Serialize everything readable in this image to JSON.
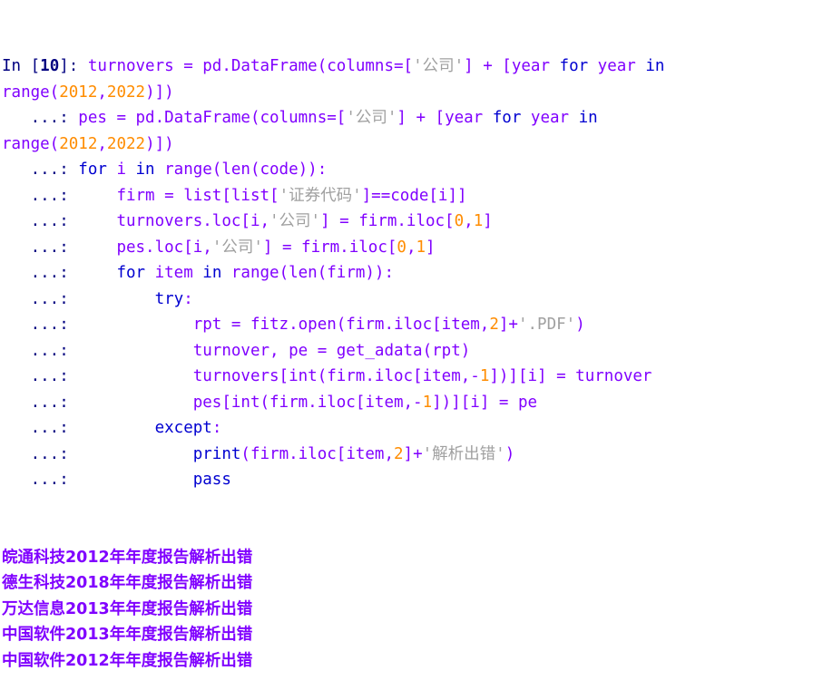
{
  "console": {
    "app": "IPython console",
    "prompts": {
      "in_label": "In",
      "in_open_bracket": "[",
      "in_number": "10",
      "in_close_bracket": "]:",
      "continuation": "   ...:"
    },
    "code_lines": [
      {
        "id": "line-1",
        "prompt_type": "in",
        "tokens": [
          {
            "t": "In ",
            "c": "prompt"
          },
          {
            "t": "[",
            "c": "prompt"
          },
          {
            "t": "10",
            "c": "prompt-num"
          },
          {
            "t": "]: ",
            "c": "prompt"
          },
          {
            "t": "turnovers = pd.DataFrame(columns=[",
            "c": "code"
          },
          {
            "t": "'公司'",
            "c": "str"
          },
          {
            "t": "] + [",
            "c": "code"
          },
          {
            "t": "year ",
            "c": "code"
          },
          {
            "t": "for",
            "c": "kw"
          },
          {
            "t": " year ",
            "c": "code"
          },
          {
            "t": "in",
            "c": "kw"
          },
          {
            "t": "",
            "c": "code"
          }
        ]
      },
      {
        "id": "line-2",
        "prompt_type": "wrap",
        "tokens": [
          {
            "t": "range(",
            "c": "code"
          },
          {
            "t": "2012",
            "c": "num"
          },
          {
            "t": ",",
            "c": "code"
          },
          {
            "t": "2022",
            "c": "num"
          },
          {
            "t": ")])",
            "c": "code"
          }
        ]
      },
      {
        "id": "line-3",
        "prompt_type": "cont",
        "tokens": [
          {
            "t": "   ...: ",
            "c": "prompt"
          },
          {
            "t": "pes = pd.DataFrame(columns=[",
            "c": "code"
          },
          {
            "t": "'公司'",
            "c": "str"
          },
          {
            "t": "] + [",
            "c": "code"
          },
          {
            "t": "year ",
            "c": "code"
          },
          {
            "t": "for",
            "c": "kw"
          },
          {
            "t": " year ",
            "c": "code"
          },
          {
            "t": "in",
            "c": "kw"
          },
          {
            "t": "",
            "c": "code"
          }
        ]
      },
      {
        "id": "line-4",
        "prompt_type": "wrap",
        "tokens": [
          {
            "t": "range(",
            "c": "code"
          },
          {
            "t": "2012",
            "c": "num"
          },
          {
            "t": ",",
            "c": "code"
          },
          {
            "t": "2022",
            "c": "num"
          },
          {
            "t": ")])",
            "c": "code"
          }
        ]
      },
      {
        "id": "line-5",
        "prompt_type": "cont",
        "tokens": [
          {
            "t": "   ...: ",
            "c": "prompt"
          },
          {
            "t": "for",
            "c": "kw"
          },
          {
            "t": " i ",
            "c": "code"
          },
          {
            "t": "in",
            "c": "kw"
          },
          {
            "t": " range(len(code)):",
            "c": "code"
          }
        ]
      },
      {
        "id": "line-6",
        "prompt_type": "cont",
        "tokens": [
          {
            "t": "   ...: ",
            "c": "prompt"
          },
          {
            "t": "    firm = list[list[",
            "c": "code"
          },
          {
            "t": "'证券代码'",
            "c": "str"
          },
          {
            "t": "]==code[i]]",
            "c": "code"
          }
        ]
      },
      {
        "id": "line-7",
        "prompt_type": "cont",
        "tokens": [
          {
            "t": "   ...: ",
            "c": "prompt"
          },
          {
            "t": "    turnovers.loc[i,",
            "c": "code"
          },
          {
            "t": "'公司'",
            "c": "str"
          },
          {
            "t": "] = firm.iloc[",
            "c": "code"
          },
          {
            "t": "0",
            "c": "num"
          },
          {
            "t": ",",
            "c": "code"
          },
          {
            "t": "1",
            "c": "num"
          },
          {
            "t": "]",
            "c": "code"
          }
        ]
      },
      {
        "id": "line-8",
        "prompt_type": "cont",
        "tokens": [
          {
            "t": "   ...: ",
            "c": "prompt"
          },
          {
            "t": "    pes.loc[i,",
            "c": "code"
          },
          {
            "t": "'公司'",
            "c": "str"
          },
          {
            "t": "] = firm.iloc[",
            "c": "code"
          },
          {
            "t": "0",
            "c": "num"
          },
          {
            "t": ",",
            "c": "code"
          },
          {
            "t": "1",
            "c": "num"
          },
          {
            "t": "]",
            "c": "code"
          }
        ]
      },
      {
        "id": "line-9",
        "prompt_type": "cont",
        "tokens": [
          {
            "t": "   ...: ",
            "c": "prompt"
          },
          {
            "t": "    ",
            "c": "code"
          },
          {
            "t": "for",
            "c": "kw"
          },
          {
            "t": " item ",
            "c": "code"
          },
          {
            "t": "in",
            "c": "kw"
          },
          {
            "t": " range(len(firm)):",
            "c": "code"
          }
        ]
      },
      {
        "id": "line-10",
        "prompt_type": "cont",
        "tokens": [
          {
            "t": "   ...: ",
            "c": "prompt"
          },
          {
            "t": "        ",
            "c": "code"
          },
          {
            "t": "try",
            "c": "kw"
          },
          {
            "t": ":",
            "c": "code"
          }
        ]
      },
      {
        "id": "line-11",
        "prompt_type": "cont",
        "tokens": [
          {
            "t": "   ...: ",
            "c": "prompt"
          },
          {
            "t": "            rpt = fitz.open(firm.iloc[item,",
            "c": "code"
          },
          {
            "t": "2",
            "c": "num"
          },
          {
            "t": "]+",
            "c": "code"
          },
          {
            "t": "'.PDF'",
            "c": "str"
          },
          {
            "t": ")",
            "c": "code"
          }
        ]
      },
      {
        "id": "line-12",
        "prompt_type": "cont",
        "tokens": [
          {
            "t": "   ...: ",
            "c": "prompt"
          },
          {
            "t": "            turnover, pe = get_adata(rpt)",
            "c": "code"
          }
        ]
      },
      {
        "id": "line-13",
        "prompt_type": "cont",
        "tokens": [
          {
            "t": "   ...: ",
            "c": "prompt"
          },
          {
            "t": "            turnovers[int(firm.iloc[item,-",
            "c": "code"
          },
          {
            "t": "1",
            "c": "num"
          },
          {
            "t": "])][i] = turnover",
            "c": "code"
          }
        ]
      },
      {
        "id": "line-14",
        "prompt_type": "cont",
        "tokens": [
          {
            "t": "   ...: ",
            "c": "prompt"
          },
          {
            "t": "            pes[int(firm.iloc[item,-",
            "c": "code"
          },
          {
            "t": "1",
            "c": "num"
          },
          {
            "t": "])][i] = pe",
            "c": "code"
          }
        ]
      },
      {
        "id": "line-15",
        "prompt_type": "cont",
        "tokens": [
          {
            "t": "   ...: ",
            "c": "prompt"
          },
          {
            "t": "        ",
            "c": "code"
          },
          {
            "t": "except",
            "c": "kw"
          },
          {
            "t": ":",
            "c": "code"
          }
        ]
      },
      {
        "id": "line-16",
        "prompt_type": "cont",
        "tokens": [
          {
            "t": "   ...: ",
            "c": "prompt"
          },
          {
            "t": "            ",
            "c": "code"
          },
          {
            "t": "print",
            "c": "builtin"
          },
          {
            "t": "(firm.iloc[item,",
            "c": "code"
          },
          {
            "t": "2",
            "c": "num"
          },
          {
            "t": "]+",
            "c": "code"
          },
          {
            "t": "'解析出错'",
            "c": "str"
          },
          {
            "t": ")",
            "c": "code"
          }
        ]
      },
      {
        "id": "line-17",
        "prompt_type": "cont",
        "tokens": [
          {
            "t": "   ...: ",
            "c": "prompt"
          },
          {
            "t": "            ",
            "c": "code"
          },
          {
            "t": "pass",
            "c": "kw"
          }
        ]
      }
    ],
    "output_lines": [
      "皖通科技2012年年度报告解析出错",
      "德生科技2018年年度报告解析出错",
      "万达信息2013年年度报告解析出错",
      "中国软件2013年年度报告解析出错",
      "中国软件2012年年度报告解析出错"
    ]
  },
  "colors": {
    "background": "#ffffff",
    "prompt": "#000080",
    "code": "#8000ff",
    "keyword": "#0000d0",
    "number": "#ff8c00",
    "string": "#a0a0a0",
    "output": "#8000ff"
  }
}
